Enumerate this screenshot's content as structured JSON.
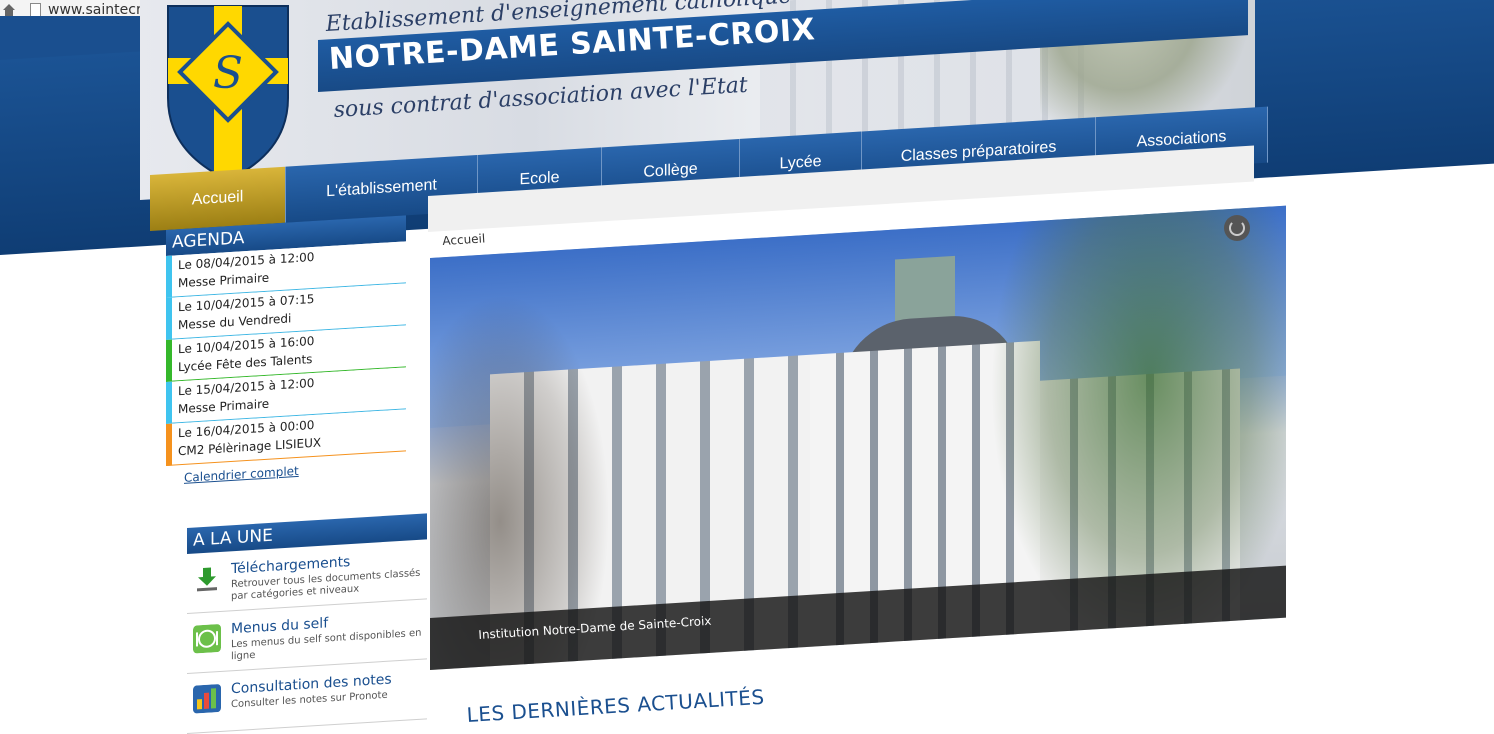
{
  "browser": {
    "url": "www.saintecroix-de-neuilly.com"
  },
  "header": {
    "tagline_top": "Etablissement d'enseignement catholique",
    "title": "NOTRE-DAME SAINTE-CROIX",
    "tagline_bottom": "sous contrat d'association avec l'Etat",
    "crest_monogram": "S"
  },
  "nav": {
    "items": [
      {
        "label": "Accueil",
        "active": true
      },
      {
        "label": "L'établissement"
      },
      {
        "label": "Ecole"
      },
      {
        "label": "Collège"
      },
      {
        "label": "Lycée"
      },
      {
        "label": "Classes préparatoires"
      },
      {
        "label": "Associations"
      }
    ]
  },
  "agenda": {
    "title": "AGENDA",
    "items": [
      {
        "date": "Le 08/04/2015 à 12:00",
        "title": "Messe Primaire",
        "color": "#3fc4ef"
      },
      {
        "date": "Le 10/04/2015 à 07:15",
        "title": "Messe du Vendredi",
        "color": "#3fc4ef"
      },
      {
        "date": "Le 10/04/2015 à 16:00",
        "title": "Lycée Fête des Talents",
        "color": "#35b82b"
      },
      {
        "date": "Le 15/04/2015 à 12:00",
        "title": "Messe Primaire",
        "color": "#3fc4ef"
      },
      {
        "date": "Le 16/04/2015 à 00:00",
        "title": "CM2 Pélèrinage LISIEUX",
        "color": "#f5921e"
      }
    ],
    "link": "Calendrier complet"
  },
  "une": {
    "title": "A LA UNE",
    "items": [
      {
        "title": "Téléchargements",
        "desc": "Retrouver tous les documents classés par catégories et niveaux",
        "icon": "download-icon"
      },
      {
        "title": "Menus du self",
        "desc": "Les menus du self sont disponibles en ligne",
        "icon": "plate-icon"
      },
      {
        "title": "Consultation des notes",
        "desc": "Consulter les notes sur Pronote",
        "icon": "grades-icon"
      }
    ]
  },
  "main": {
    "breadcrumb": "Accueil",
    "slide_caption": "Institution Notre-Dame de Sainte-Croix",
    "news_title": "LES DERNIÈRES ACTUALITÉS"
  },
  "colors": {
    "brand_blue": "#1a4f8f",
    "active_gold": "#c9a52a"
  }
}
